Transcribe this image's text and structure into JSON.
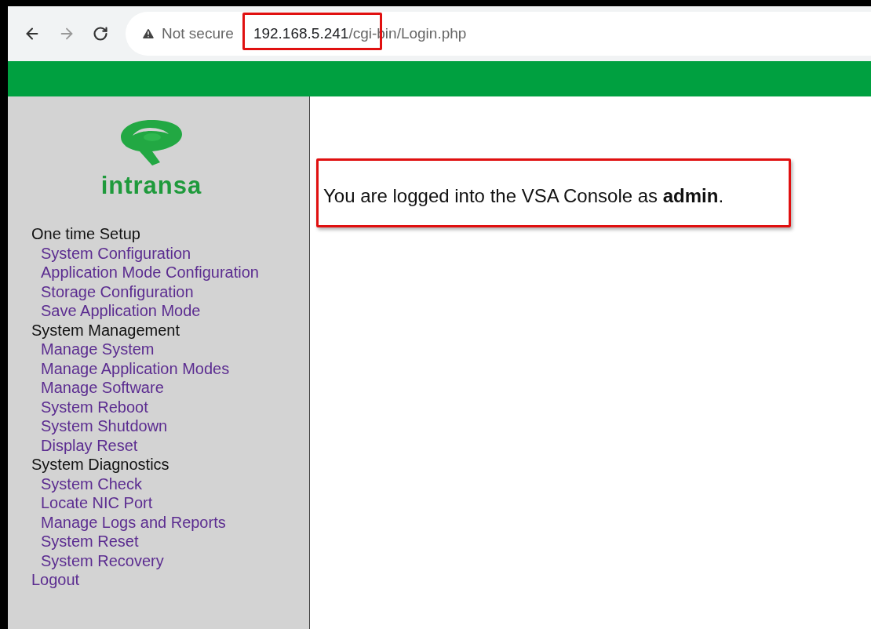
{
  "browser": {
    "security_label": "Not secure",
    "url_host": "192.168.5.241",
    "url_path": "/cgi-bin/Login.php"
  },
  "sidebar": {
    "logo_text": "intransa",
    "sections": [
      {
        "title": "One time Setup",
        "items": [
          "System Configuration",
          "Application Mode Configuration",
          "Storage Configuration",
          "Save Application Mode"
        ]
      },
      {
        "title": "System Management",
        "items": [
          "Manage System",
          "Manage Application Modes",
          "Manage Software",
          "System Reboot",
          "System Shutdown",
          "Display Reset"
        ]
      },
      {
        "title": "System Diagnostics",
        "items": [
          "System Check",
          "Locate NIC Port",
          "Manage Logs and Reports",
          "System Reset",
          "System Recovery"
        ]
      }
    ],
    "logout": "Logout"
  },
  "message": "You are logged into the VSA Console as **admin**."
}
